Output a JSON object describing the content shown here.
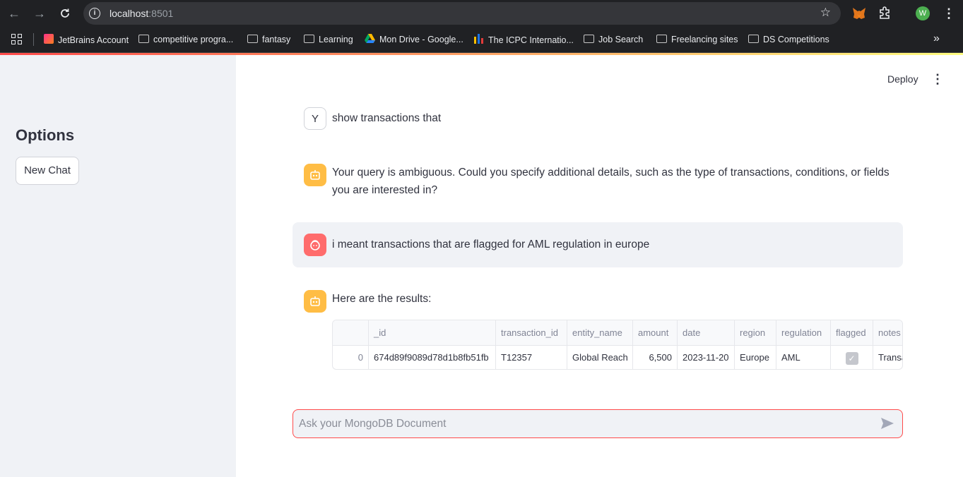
{
  "browser": {
    "url_host": "localhost",
    "url_port": ":8501",
    "bookmarks": [
      {
        "label": "JetBrains Account"
      },
      {
        "label": "competitive progra..."
      },
      {
        "label": "fantasy"
      },
      {
        "label": "Learning"
      },
      {
        "label": "Mon Drive - Google..."
      },
      {
        "label": "The ICPC Internatio..."
      },
      {
        "label": "Job Search"
      },
      {
        "label": "Freelancing sites"
      },
      {
        "label": "DS Competitions"
      }
    ],
    "profile_initial": "W"
  },
  "app": {
    "deploy_label": "Deploy",
    "sidebar": {
      "title": "Options",
      "new_chat_label": "New Chat"
    },
    "messages": [
      {
        "avatar": "Y",
        "text": "show transactions that"
      },
      {
        "text": "Your query is ambiguous. Could you specify additional details, such as the type of transactions, conditions, or fields you are interested in?"
      },
      {
        "text": "i meant transactions that are flagged for AML regulation in europe"
      },
      {
        "text": "Here are the results:"
      }
    ],
    "table": {
      "columns": [
        "",
        "_id",
        "transaction_id",
        "entity_name",
        "amount",
        "date",
        "region",
        "regulation",
        "flagged",
        "notes"
      ],
      "rows": [
        [
          "0",
          "674d89f9089d78d1b8fb51fb",
          "T12357",
          "Global Reach",
          "6,500",
          "2023-11-20",
          "Europe",
          "AML",
          "✓",
          "Transa"
        ]
      ]
    },
    "chat_input": {
      "placeholder": "Ask your MongoDB Document"
    },
    "colors": {
      "accent": "#ff4b4b",
      "bot_avatar": "#ffbd45",
      "user_avatar": "#ff6c6c",
      "sidebar_bg": "#f0f2f6"
    }
  }
}
